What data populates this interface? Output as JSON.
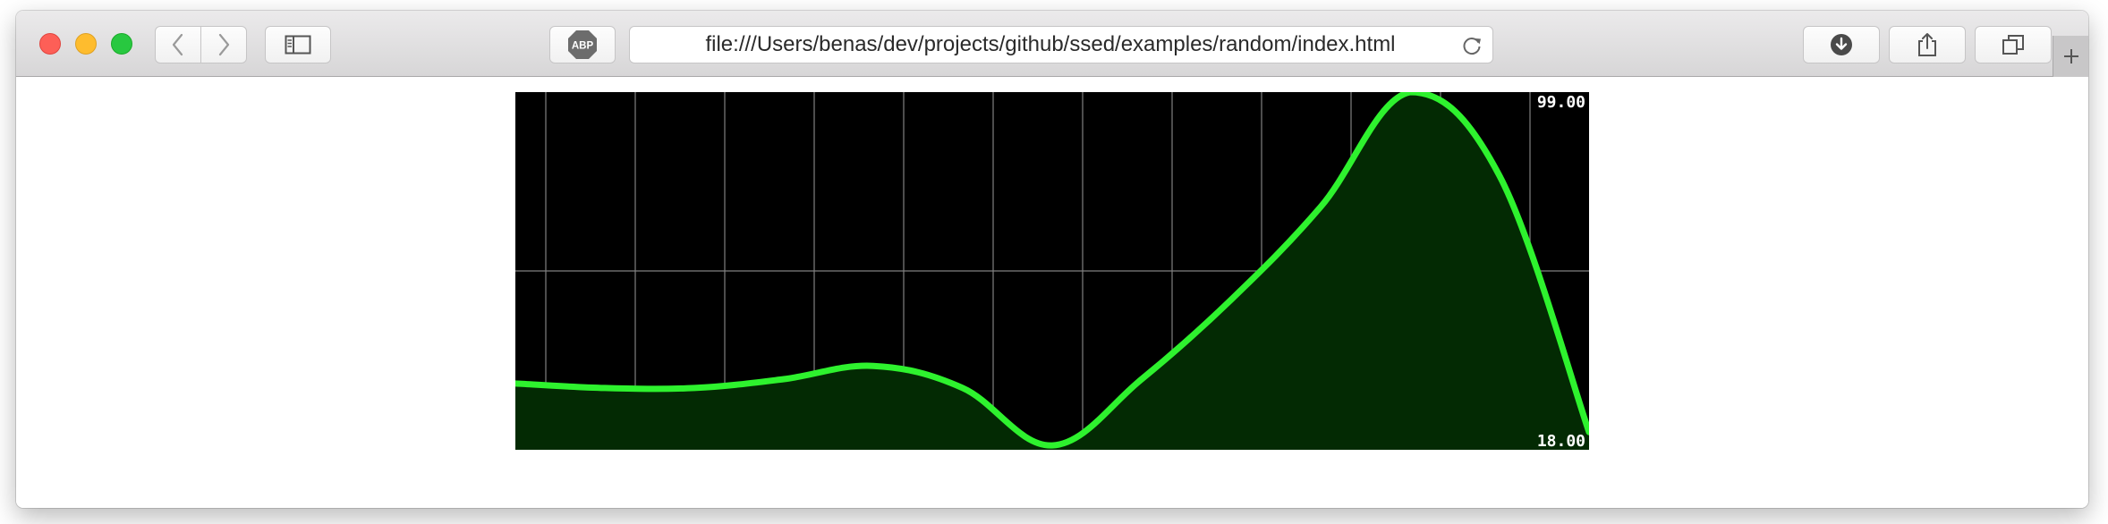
{
  "browser": {
    "url": "file:///Users/benas/dev/projects/github/ssed/examples/random/index.html",
    "abp_label": "ABP",
    "buttons": {
      "close": "close-window",
      "minimize": "minimize-window",
      "zoom": "zoom-window",
      "back_icon": "chevron-left-icon",
      "forward_icon": "chevron-right-icon",
      "sidebar_icon": "sidebar-icon",
      "download_icon": "download-icon",
      "share_icon": "share-icon",
      "tabs_icon": "tab-overview-icon",
      "reload_icon": "reload-icon",
      "new_tab_icon": "plus-icon"
    }
  },
  "colors": {
    "line": "#2ef22e",
    "fill": "#032a03",
    "grid": "#808080",
    "background": "#000000",
    "label": "#ffffff"
  },
  "chart_data": {
    "type": "area",
    "title": "",
    "xlabel": "",
    "ylabel": "",
    "ylim": [
      18,
      99
    ],
    "y_labels": [
      "99.00",
      "18.00"
    ],
    "grid": true,
    "x": [
      0,
      1,
      2,
      3,
      4,
      5,
      6,
      7,
      8,
      9,
      10,
      11,
      12
    ],
    "series": [
      {
        "values": [
          33,
          32,
          32,
          34,
          37,
          32,
          19,
          34,
          52,
          73,
          99,
          80,
          22
        ]
      }
    ]
  }
}
